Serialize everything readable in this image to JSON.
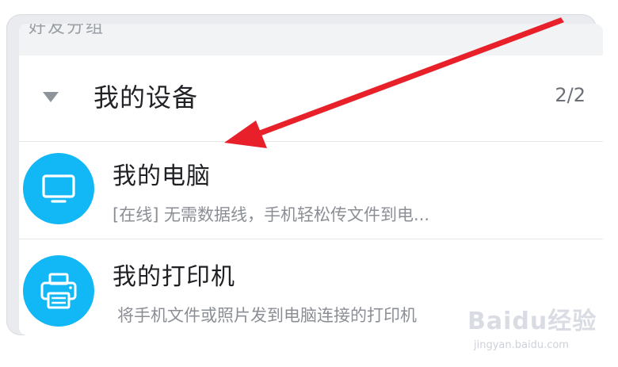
{
  "top_strip": {
    "label": "好友分组"
  },
  "group": {
    "title": "我的设备",
    "count": "2/2",
    "expand_icon": "triangle-down-icon"
  },
  "devices": [
    {
      "name": "我的电脑",
      "description": "[在线] 无需数据线，手机轻松传文件到电...",
      "icon": "monitor-icon"
    },
    {
      "name": "我的打印机",
      "description": "将手机文件或照片发到电脑连接的打印机",
      "icon": "printer-icon"
    }
  ],
  "annotation": {
    "arrow_color": "#e8202a"
  },
  "theme": {
    "accent": "#12b7f5"
  },
  "watermark": {
    "main": "Baidu经验",
    "sub": "jingyan.baidu.com"
  }
}
